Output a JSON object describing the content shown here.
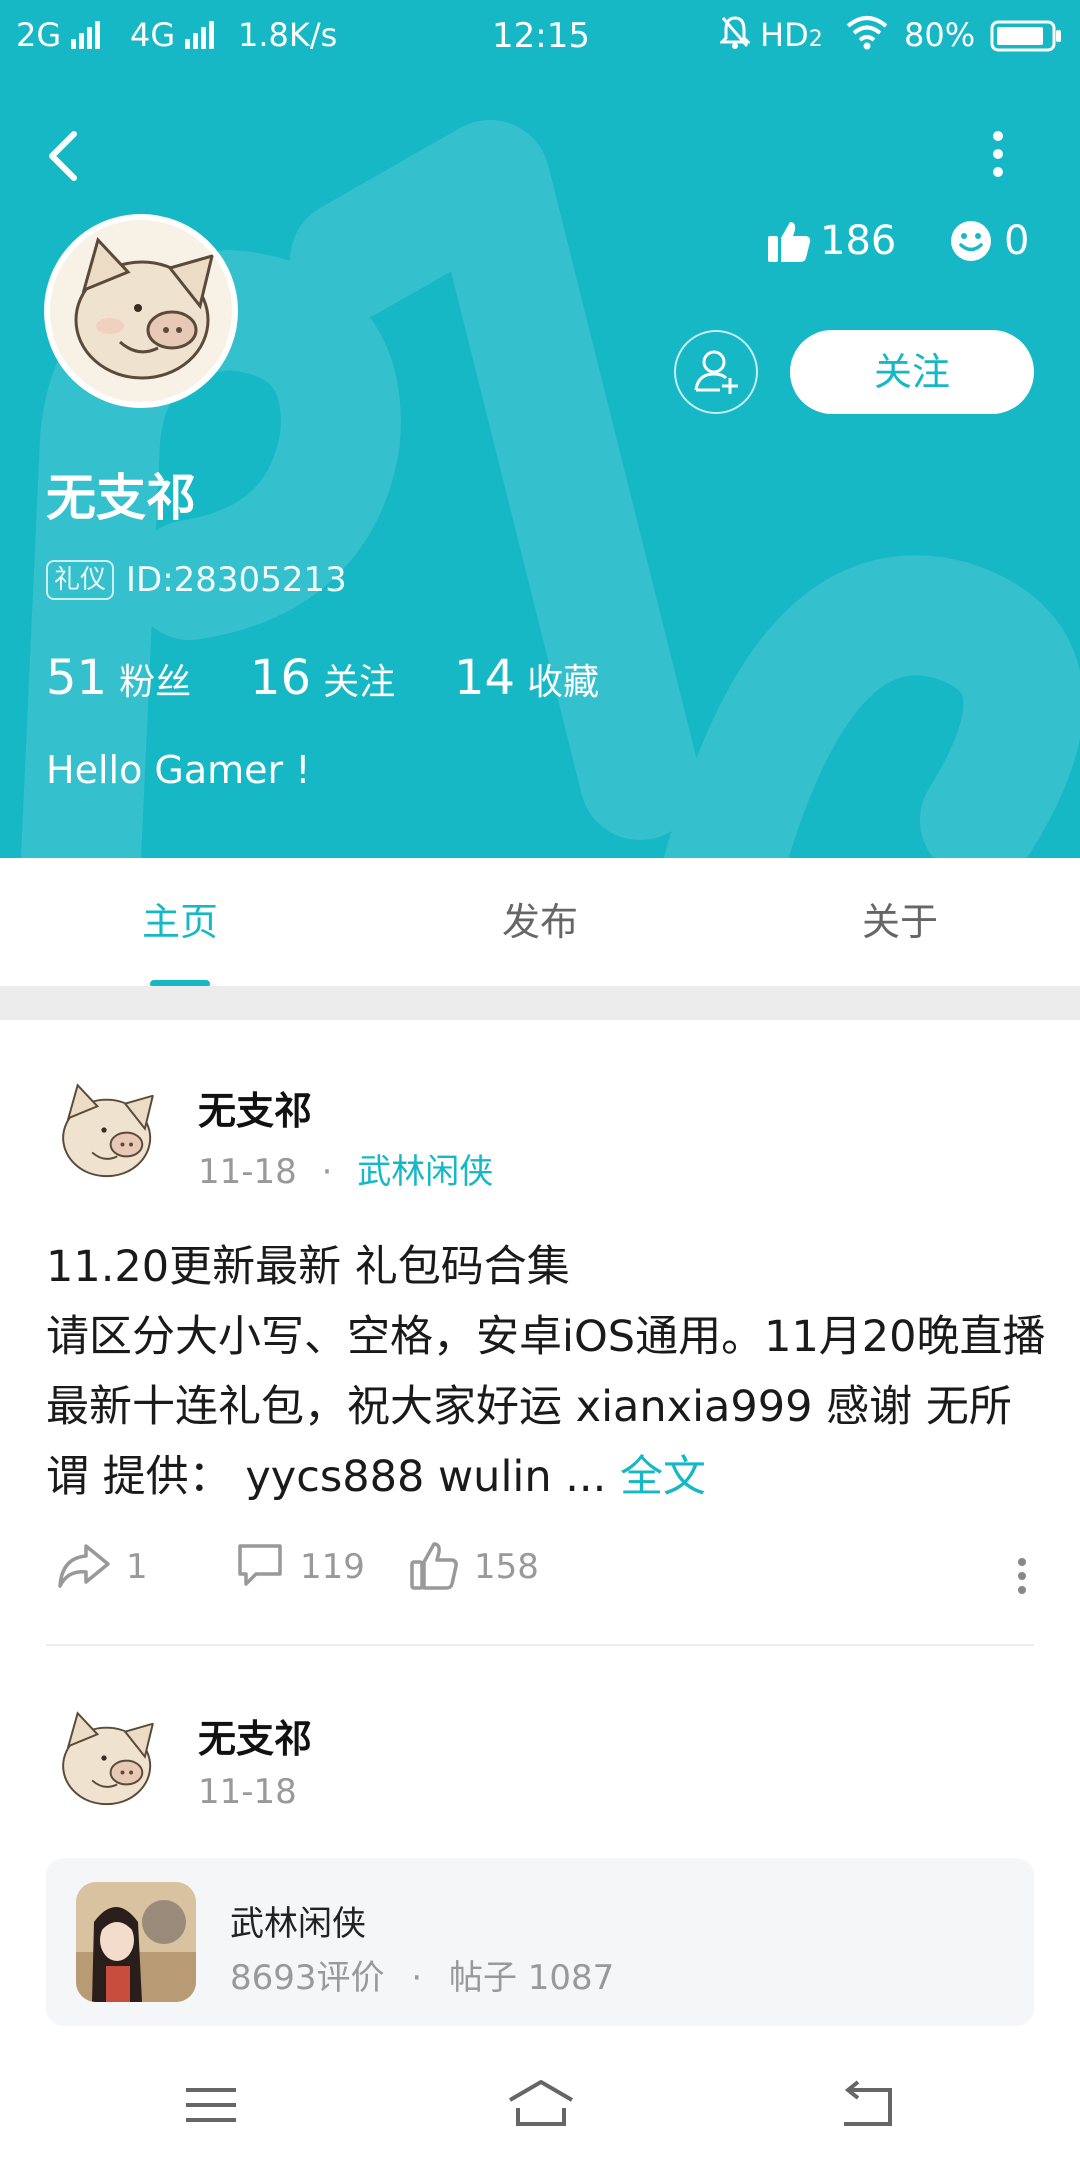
{
  "status_bar": {
    "network_left": "2G",
    "network_right": "4G",
    "speed": "1.8K/s",
    "time": "12:15",
    "hd": "HD",
    "hd_sub": "2",
    "battery": "80%"
  },
  "profile": {
    "likes": "186",
    "smiles": "0",
    "follow_label": "关注",
    "name": "无支祁",
    "role_badge": "礼仪",
    "id_text": "ID:28305213",
    "stats": {
      "fans_count": "51",
      "fans_label": "粉丝",
      "following_count": "16",
      "following_label": "关注",
      "favorites_count": "14",
      "favorites_label": "收藏"
    },
    "bio": "Hello Gamer !"
  },
  "tabs": {
    "home": "主页",
    "posts": "发布",
    "about": "关于",
    "active": "home"
  },
  "post1": {
    "author": "无支祁",
    "date": "11-18",
    "dot": "·",
    "game_tag": "武林闲侠",
    "body": "11.20更新最新 礼包码合集\n请区分大小写、空格，安卓iOS通用。11月20晚直播最新十连礼包，祝大家好运 xianxia999 感谢 无所谓 提供： yycs888 wulin ... ",
    "more_label": "全文",
    "shares": "1",
    "comments": "119",
    "likes": "158"
  },
  "post2": {
    "author": "无支祁",
    "date": "11-18",
    "game": {
      "name": "武林闲侠",
      "reviews": "8693评价",
      "dot": "·",
      "posts": "帖子 1087"
    }
  },
  "colors": {
    "accent": "#17b8c6",
    "header_bg": "#17b8c6",
    "muted_text": "#999999"
  },
  "icons": [
    "back-arrow-icon",
    "more-vertical-icon",
    "thumbs-up-icon",
    "smiley-icon",
    "add-friend-icon",
    "share-icon",
    "comment-icon",
    "like-icon",
    "menu-icon",
    "home-icon",
    "return-icon"
  ]
}
